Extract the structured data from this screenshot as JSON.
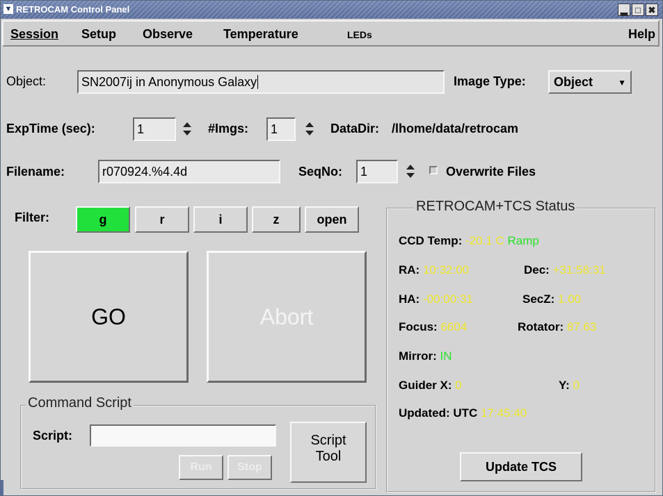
{
  "window": {
    "title": "RETROCAM Control Panel",
    "minimize_label": "▂",
    "maximize_label": "□",
    "close_label": "✖"
  },
  "menubar": {
    "items": [
      "Session",
      "Setup",
      "Observe",
      "Temperature",
      "LEDs"
    ],
    "help": "Help"
  },
  "object": {
    "label": "Object:",
    "value": "SN2007ij in Anonymous Galaxy",
    "image_type_label": "Image Type:",
    "image_type_value": "Object"
  },
  "exposure": {
    "exptime_label": "ExpTime (sec):",
    "exptime_value": "1",
    "nimgs_label": "#Imgs:",
    "nimgs_value": "1",
    "datadir_label": "DataDir:",
    "datadir_value": "/lhome/data/retrocam"
  },
  "file": {
    "filename_label": "Filename:",
    "filename_value": "r070924.%4.4d",
    "seqno_label": "SeqNo:",
    "seqno_value": "1",
    "overwrite_label": "Overwrite Files",
    "overwrite_checked": false
  },
  "filter": {
    "label": "Filter:",
    "options": [
      "g",
      "r",
      "i",
      "z",
      "open"
    ],
    "selected": "g",
    "selected_color": "#22e03c"
  },
  "actions": {
    "go_label": "GO",
    "abort_label": "Abort"
  },
  "script": {
    "group_title": "Command Script",
    "script_label": "Script:",
    "script_value": "",
    "run_label": "Run",
    "stop_label": "Stop",
    "tool_label_line1": "Script",
    "tool_label_line2": "Tool"
  },
  "status": {
    "title": "RETROCAM+TCS Status",
    "ccd_temp_label": "CCD Temp:",
    "ccd_temp_value": "-20.1 C",
    "ccd_mode_value": "Ramp",
    "ra_label": "RA:",
    "ra_value": "10:32:00",
    "dec_label": "Dec:",
    "dec_value": "+31:58:31",
    "ha_label": "HA:",
    "ha_value": "-00:00:31",
    "secz_label": "SecZ:",
    "secz_value": "1.00",
    "focus_label": "Focus:",
    "focus_value": "6604",
    "rotator_label": "Rotator:",
    "rotator_value": "87.63",
    "mirror_label": "Mirror:",
    "mirror_value": "IN",
    "guider_x_label": "Guider X:",
    "guider_x_value": "0",
    "guider_y_label": "Y:",
    "guider_y_value": "0",
    "updated_label": "Updated: UTC",
    "updated_value": "17:45:40",
    "update_button": "Update TCS",
    "yellow_color": "#f2e92e",
    "green_color": "#28e028"
  }
}
